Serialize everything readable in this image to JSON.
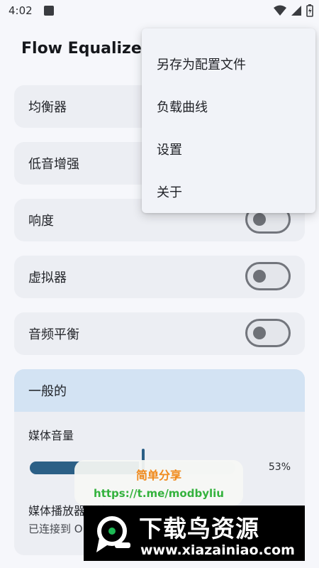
{
  "status_bar": {
    "time": "4:02"
  },
  "app": {
    "title": "Flow Equalizer"
  },
  "cards": [
    {
      "label": "均衡器",
      "toggle": false,
      "toggle_on": false
    },
    {
      "label": "低音增强",
      "toggle": false,
      "toggle_on": false
    },
    {
      "label": "响度",
      "toggle": true,
      "toggle_on": false
    },
    {
      "label": "虚拟器",
      "toggle": true,
      "toggle_on": false
    },
    {
      "label": "音频平衡",
      "toggle": true,
      "toggle_on": false
    }
  ],
  "general": {
    "header": "一般的",
    "media_volume_label": "媒体音量",
    "media_volume_value": 0.53,
    "media_volume_percent": "53%",
    "connect_title": "媒体播放器连接",
    "connect_subtitle": "已连接到 O"
  },
  "menu": {
    "items": [
      "另存为配置文件",
      "负载曲线",
      "设置",
      "关于"
    ]
  },
  "watermark": {
    "share_title": "简单分享",
    "share_link": "https://t.me/modbyliu",
    "banner_title": "下载鸟资源",
    "banner_url": "www.xiazainiao.com"
  },
  "colors": {
    "accent": "#2b5f86",
    "card_bg": "#eceef3",
    "header_bg": "#d3e3f3",
    "share_orange": "#f08a1c",
    "share_green": "#34b23d"
  }
}
